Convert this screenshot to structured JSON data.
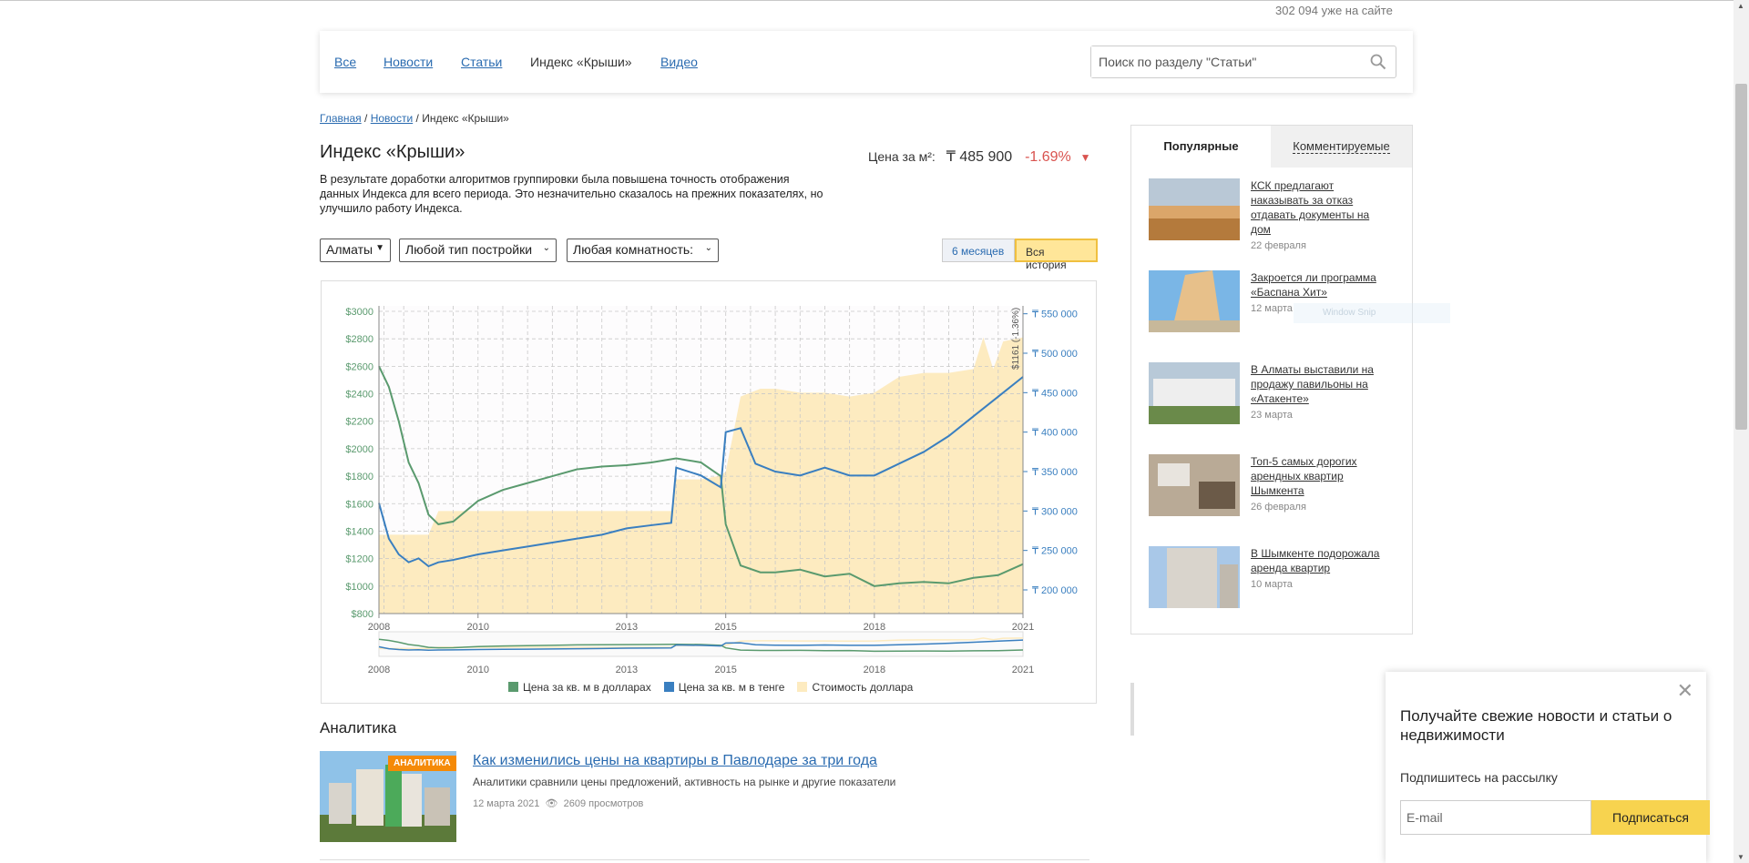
{
  "visitors": "302 094 уже на сайте",
  "nav": {
    "items": [
      {
        "label": "Все",
        "active": false
      },
      {
        "label": "Новости",
        "active": false
      },
      {
        "label": "Статьи",
        "active": false
      },
      {
        "label": "Индекс «Крыши»",
        "active": true
      },
      {
        "label": "Видео",
        "active": false
      }
    ],
    "search_placeholder": "Поиск по разделу \"Статьи\""
  },
  "breadcrumb": {
    "home": "Главная",
    "sep1": "/",
    "news": "Новости",
    "sep2": "/",
    "current": "Индекс «Крыши»"
  },
  "page": {
    "title": "Индекс «Крыши»",
    "description": "В результате доработки алгоритмов группировки была повышена точность отображения данных Индекса для всего периода. Это незначительно сказалось на прежних показателях, но улучшило работу Индекса."
  },
  "price": {
    "label": "Цена за м²:",
    "value": "₸ 485 900",
    "change": "-1.69%",
    "arrow": "▼"
  },
  "filters": {
    "city": "Алматы",
    "building_type": "Любой тип постройки",
    "rooms": "Любая комнатность:"
  },
  "range_buttons": {
    "six_months": "6 месяцев",
    "all_history": "Вся история"
  },
  "chart_data": {
    "type": "line",
    "x_ticks": [
      "2008",
      "2010",
      "2013",
      "2015",
      "2018",
      "2021"
    ],
    "navigator_x_ticks": [
      "2008",
      "2010",
      "2013",
      "2015",
      "2018",
      "2021"
    ],
    "y_left_ticks": [
      "$800",
      "$1000",
      "$1200",
      "$1400",
      "$1600",
      "$1800",
      "$2000",
      "$2200",
      "$2400",
      "$2600",
      "$2800",
      "$3000"
    ],
    "y_left_range": [
      800,
      3000
    ],
    "y_right_ticks": [
      "₸ 200 000",
      "₸ 250 000",
      "₸ 300 000",
      "₸ 350 000",
      "₸ 400 000",
      "₸ 450 000",
      "₸ 500 000",
      "₸ 550 000"
    ],
    "y_right_range": [
      170000,
      560000
    ],
    "annotation": "$1161 (-1.36%)",
    "grid": true,
    "legend_position": "bottom",
    "series": [
      {
        "name": "Цена за кв. м в долларах",
        "color": "#5a9a6e",
        "axis": "left",
        "x": [
          2008.0,
          2008.2,
          2008.4,
          2008.6,
          2008.8,
          2009.0,
          2009.2,
          2009.5,
          2010.0,
          2010.5,
          2011.0,
          2011.5,
          2012.0,
          2012.5,
          2013.0,
          2013.5,
          2014.0,
          2014.5,
          2014.9,
          2015.0,
          2015.3,
          2015.7,
          2016.0,
          2016.5,
          2017.0,
          2017.5,
          2018.0,
          2018.5,
          2019.0,
          2019.5,
          2020.0,
          2020.5,
          2021.0
        ],
        "values": [
          2600,
          2450,
          2200,
          1900,
          1750,
          1520,
          1450,
          1470,
          1620,
          1700,
          1750,
          1800,
          1850,
          1870,
          1880,
          1900,
          1930,
          1900,
          1800,
          1450,
          1150,
          1100,
          1100,
          1120,
          1070,
          1090,
          1000,
          1020,
          1030,
          1020,
          1060,
          1080,
          1160
        ]
      },
      {
        "name": "Цена за кв. м в тенге",
        "color": "#3a7fc0",
        "axis": "right",
        "x": [
          2008.0,
          2008.2,
          2008.4,
          2008.6,
          2008.8,
          2009.0,
          2009.2,
          2009.5,
          2010.0,
          2010.5,
          2011.0,
          2011.5,
          2012.0,
          2012.5,
          2013.0,
          2013.5,
          2013.9,
          2014.0,
          2014.5,
          2014.9,
          2015.0,
          2015.3,
          2015.6,
          2016.0,
          2016.5,
          2017.0,
          2017.5,
          2018.0,
          2018.5,
          2019.0,
          2019.5,
          2020.0,
          2020.5,
          2021.0
        ],
        "values": [
          310000,
          265000,
          245000,
          235000,
          240000,
          230000,
          235000,
          238000,
          245000,
          250000,
          255000,
          260000,
          265000,
          270000,
          278000,
          282000,
          285000,
          355000,
          345000,
          330000,
          400000,
          405000,
          360000,
          350000,
          345000,
          355000,
          345000,
          345000,
          360000,
          375000,
          395000,
          420000,
          445000,
          470000
        ]
      },
      {
        "name": "Стоимость доллара",
        "color": "#fdebc0",
        "axis": "right",
        "type": "area",
        "x": [
          2008.0,
          2008.15,
          2009.0,
          2009.2,
          2010.0,
          2011.0,
          2012.0,
          2013.0,
          2013.9,
          2014.0,
          2014.5,
          2014.9,
          2015.0,
          2015.3,
          2015.7,
          2016.0,
          2016.5,
          2017.0,
          2017.5,
          2018.0,
          2018.5,
          2019.0,
          2019.5,
          2020.0,
          2020.2,
          2020.4,
          2020.6,
          2021.0
        ],
        "values": [
          270000,
          270000,
          270000,
          300000,
          300000,
          300000,
          300000,
          300000,
          300000,
          340000,
          340000,
          345000,
          350000,
          445000,
          455000,
          455000,
          450000,
          450000,
          445000,
          450000,
          470000,
          475000,
          475000,
          480000,
          520000,
          480000,
          515000,
          520000
        ]
      }
    ]
  },
  "analytics": {
    "section_title": "Аналитика",
    "article": {
      "badge": "АНАЛИТИКА",
      "title": "Как изменились цены на квартиры в Павлодаре за три года",
      "description": "Аналитики сравнили цены предложений, активность на рынке и другие показатели",
      "date": "12 марта 2021",
      "views": "2609 просмотров"
    }
  },
  "sidebar": {
    "tab_popular": "Популярные",
    "tab_commented": "Комментируемые",
    "items": [
      {
        "title": "КСК предлагают наказывать за отказ отдавать документы на дом",
        "date": "22 февраля"
      },
      {
        "title": "Закроется ли программа «Баспана Хит»",
        "date": "12 марта"
      },
      {
        "title": "В Алматы выставили на продажу павильоны на «Атакенте»",
        "date": "23 марта"
      },
      {
        "title": "Топ-5 самых дорогих арендных квартир Шымкента",
        "date": "26 февраля"
      },
      {
        "title": "В Шымкенте подорожала аренда квартир",
        "date": "10 марта"
      }
    ]
  },
  "ghost_overlay": "Window Snip",
  "popup": {
    "title": "Получайте свежие новости и статьи о недвижимости",
    "subtitle": "Подпишитесь на рассылку",
    "email_placeholder": "E-mail",
    "button": "Подписаться"
  }
}
